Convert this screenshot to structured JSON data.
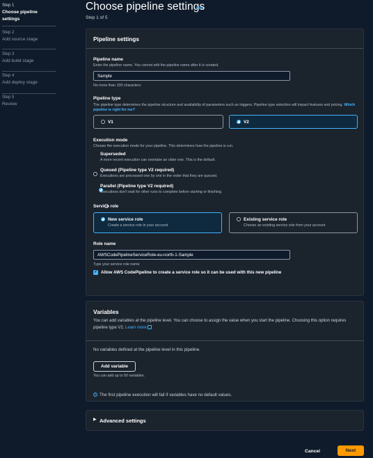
{
  "sidebar": {
    "steps": [
      {
        "num": "Step 1",
        "title": "Choose pipeline settings"
      },
      {
        "num": "Step 2",
        "title": "Add source stage"
      },
      {
        "num": "Step 3",
        "title": "Add build stage"
      },
      {
        "num": "Step 4",
        "title": "Add deploy stage"
      },
      {
        "num": "Step 5",
        "title": "Review"
      }
    ]
  },
  "header": {
    "title": "Choose pipeline settings",
    "info": "Info",
    "step_of": "Step 1 of 5"
  },
  "pipeline_settings": {
    "title": "Pipeline settings",
    "name_label": "Pipeline name",
    "name_desc": "Enter the pipeline name. You cannot edit the pipeline name after it is created.",
    "name_value": "Sample",
    "name_hint": "No more than 100 characters",
    "type_label": "Pipeline type",
    "type_desc": "The pipeline type determines the pipeline structure and availability of parameters such as triggers. Pipeline type selection will impact features and pricing.",
    "type_link": "Which pipeline is right for me?",
    "type_v1": "V1",
    "type_v2": "V2",
    "exec_label": "Execution mode",
    "exec_desc": "Choose the execution mode for your pipeline. This determines how the pipeline is run.",
    "exec_superseded": "Superseded",
    "exec_superseded_desc": "A more recent execution can overtake an older one. This is the default.",
    "exec_queued": "Queued (Pipeline type V2 required)",
    "exec_queued_desc": "Executions are processed one by one in the order that they are queued.",
    "exec_parallel": "Parallel (Pipeline type V2 required)",
    "exec_parallel_desc": "Executions don't wait for other runs to complete before starting or finishing.",
    "role_label": "Service role",
    "role_new": "New service role",
    "role_new_desc": "Create a service role in your account",
    "role_existing": "Existing service role",
    "role_existing_desc": "Choose an existing service role from your account",
    "role_name_label": "Role name",
    "role_name_value": "AWSCodePipelineServiceRole-eu-north-1-Sample",
    "role_name_hint": "Type your service role name",
    "allow_checkbox": "Allow AWS CodePipeline to create a service role so it can be used with this new pipeline"
  },
  "variables": {
    "title": "Variables",
    "desc": "You can add variables at the pipeline level. You can choose to assign the value when you start the pipeline. Choosing this option requires pipeline type V2.",
    "learn_more": "Learn more",
    "none_msg": "No variables defined at the pipeline level in this pipeline.",
    "add_button": "Add variable",
    "limit_hint": "You can add up to 50 variables.",
    "info_msg": "The first pipeline execution will fail if variables have no default values."
  },
  "advanced": {
    "title": "Advanced settings"
  },
  "footer": {
    "cancel": "Cancel",
    "next": "Next"
  },
  "colors": {
    "accent": "#42b4ff",
    "primary_button": "#ff9900",
    "background": "#0f1b2a",
    "panel": "#1b232d"
  }
}
